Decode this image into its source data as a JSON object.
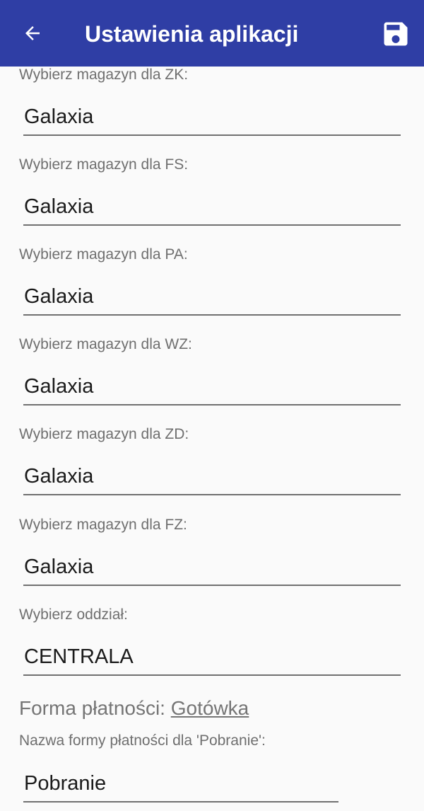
{
  "toolbar": {
    "title": "Ustawienia aplikacji",
    "back_icon": "arrow-left-icon",
    "save_icon": "save-floppy-icon",
    "background_color": "#2f3ea5"
  },
  "fields": [
    {
      "label": "Wybierz magazyn dla ZK:",
      "value": "Galaxia"
    },
    {
      "label": "Wybierz magazyn dla FS:",
      "value": "Galaxia"
    },
    {
      "label": "Wybierz magazyn dla PA:",
      "value": "Galaxia"
    },
    {
      "label": "Wybierz magazyn dla WZ:",
      "value": "Galaxia"
    },
    {
      "label": "Wybierz magazyn dla ZD:",
      "value": "Galaxia"
    },
    {
      "label": "Wybierz magazyn dla FZ:",
      "value": "Galaxia"
    },
    {
      "label": "Wybierz oddział:",
      "value": "CENTRALA"
    }
  ],
  "payment": {
    "label": "Forma płatności:",
    "value": "Gotówka"
  },
  "cod_field": {
    "label": "Nazwa formy płatności dla 'Pobranie':",
    "value": "Pobranie"
  }
}
